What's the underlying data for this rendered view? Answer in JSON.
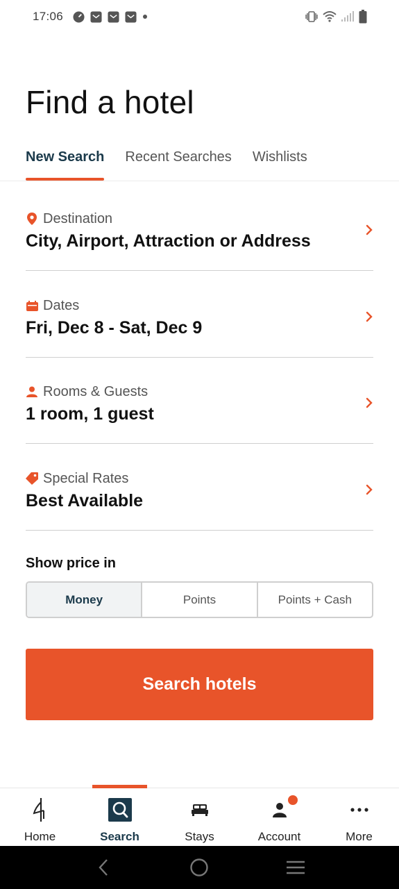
{
  "status_bar": {
    "time": "17:06"
  },
  "page": {
    "title": "Find a hotel"
  },
  "tabs": [
    {
      "label": "New Search",
      "active": true
    },
    {
      "label": "Recent Searches",
      "active": false
    },
    {
      "label": "Wishlists",
      "active": false
    }
  ],
  "fields": {
    "destination": {
      "label": "Destination",
      "value": "City, Airport, Attraction or Address",
      "icon": "location-pin-icon"
    },
    "dates": {
      "label": "Dates",
      "value": "Fri, Dec 8 - Sat, Dec 9",
      "icon": "calendar-icon"
    },
    "rooms": {
      "label": "Rooms & Guests",
      "value": "1 room, 1 guest",
      "icon": "person-icon"
    },
    "rates": {
      "label": "Special Rates",
      "value": "Best Available",
      "icon": "tag-icon"
    }
  },
  "price": {
    "label": "Show price in",
    "options": [
      {
        "label": "Money",
        "selected": true
      },
      {
        "label": "Points",
        "selected": false
      },
      {
        "label": "Points + Cash",
        "selected": false
      }
    ]
  },
  "search_button": {
    "label": "Search hotels"
  },
  "bottom_nav": [
    {
      "label": "Home",
      "icon": "hilton-logo-icon",
      "active": false
    },
    {
      "label": "Search",
      "icon": "search-icon",
      "active": true
    },
    {
      "label": "Stays",
      "icon": "bed-icon",
      "active": false
    },
    {
      "label": "Account",
      "icon": "account-icon",
      "active": false,
      "badge": true
    },
    {
      "label": "More",
      "icon": "more-dots-icon",
      "active": false
    }
  ],
  "colors": {
    "accent": "#e8542a",
    "primary_dark": "#1b3a4b",
    "text": "#111111",
    "muted": "#555555"
  }
}
